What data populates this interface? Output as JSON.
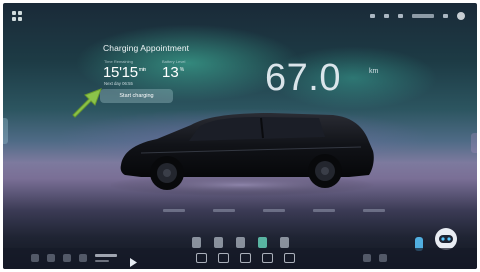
{
  "charging_card": {
    "title": "Charging Appointment",
    "time_remaining_label": "Time Remaining",
    "battery_level_label": "Battery Level",
    "time_value": "15'15",
    "time_unit": "min",
    "battery_value": "13",
    "battery_unit": "%",
    "next_day_text": "Next day 06:55",
    "start_button_label": "Start charging"
  },
  "range": {
    "value": "67.0",
    "unit": "km"
  },
  "colors": {
    "accent_green": "#8bc34a",
    "active_control": "#6ee6c8",
    "assistant_blue": "#5ac8ff"
  },
  "icons": {
    "pointer": "green-arrow-icon",
    "apps": "apps-grid-icon",
    "play": "play-icon",
    "assistant": "robot-assistant-icon"
  }
}
